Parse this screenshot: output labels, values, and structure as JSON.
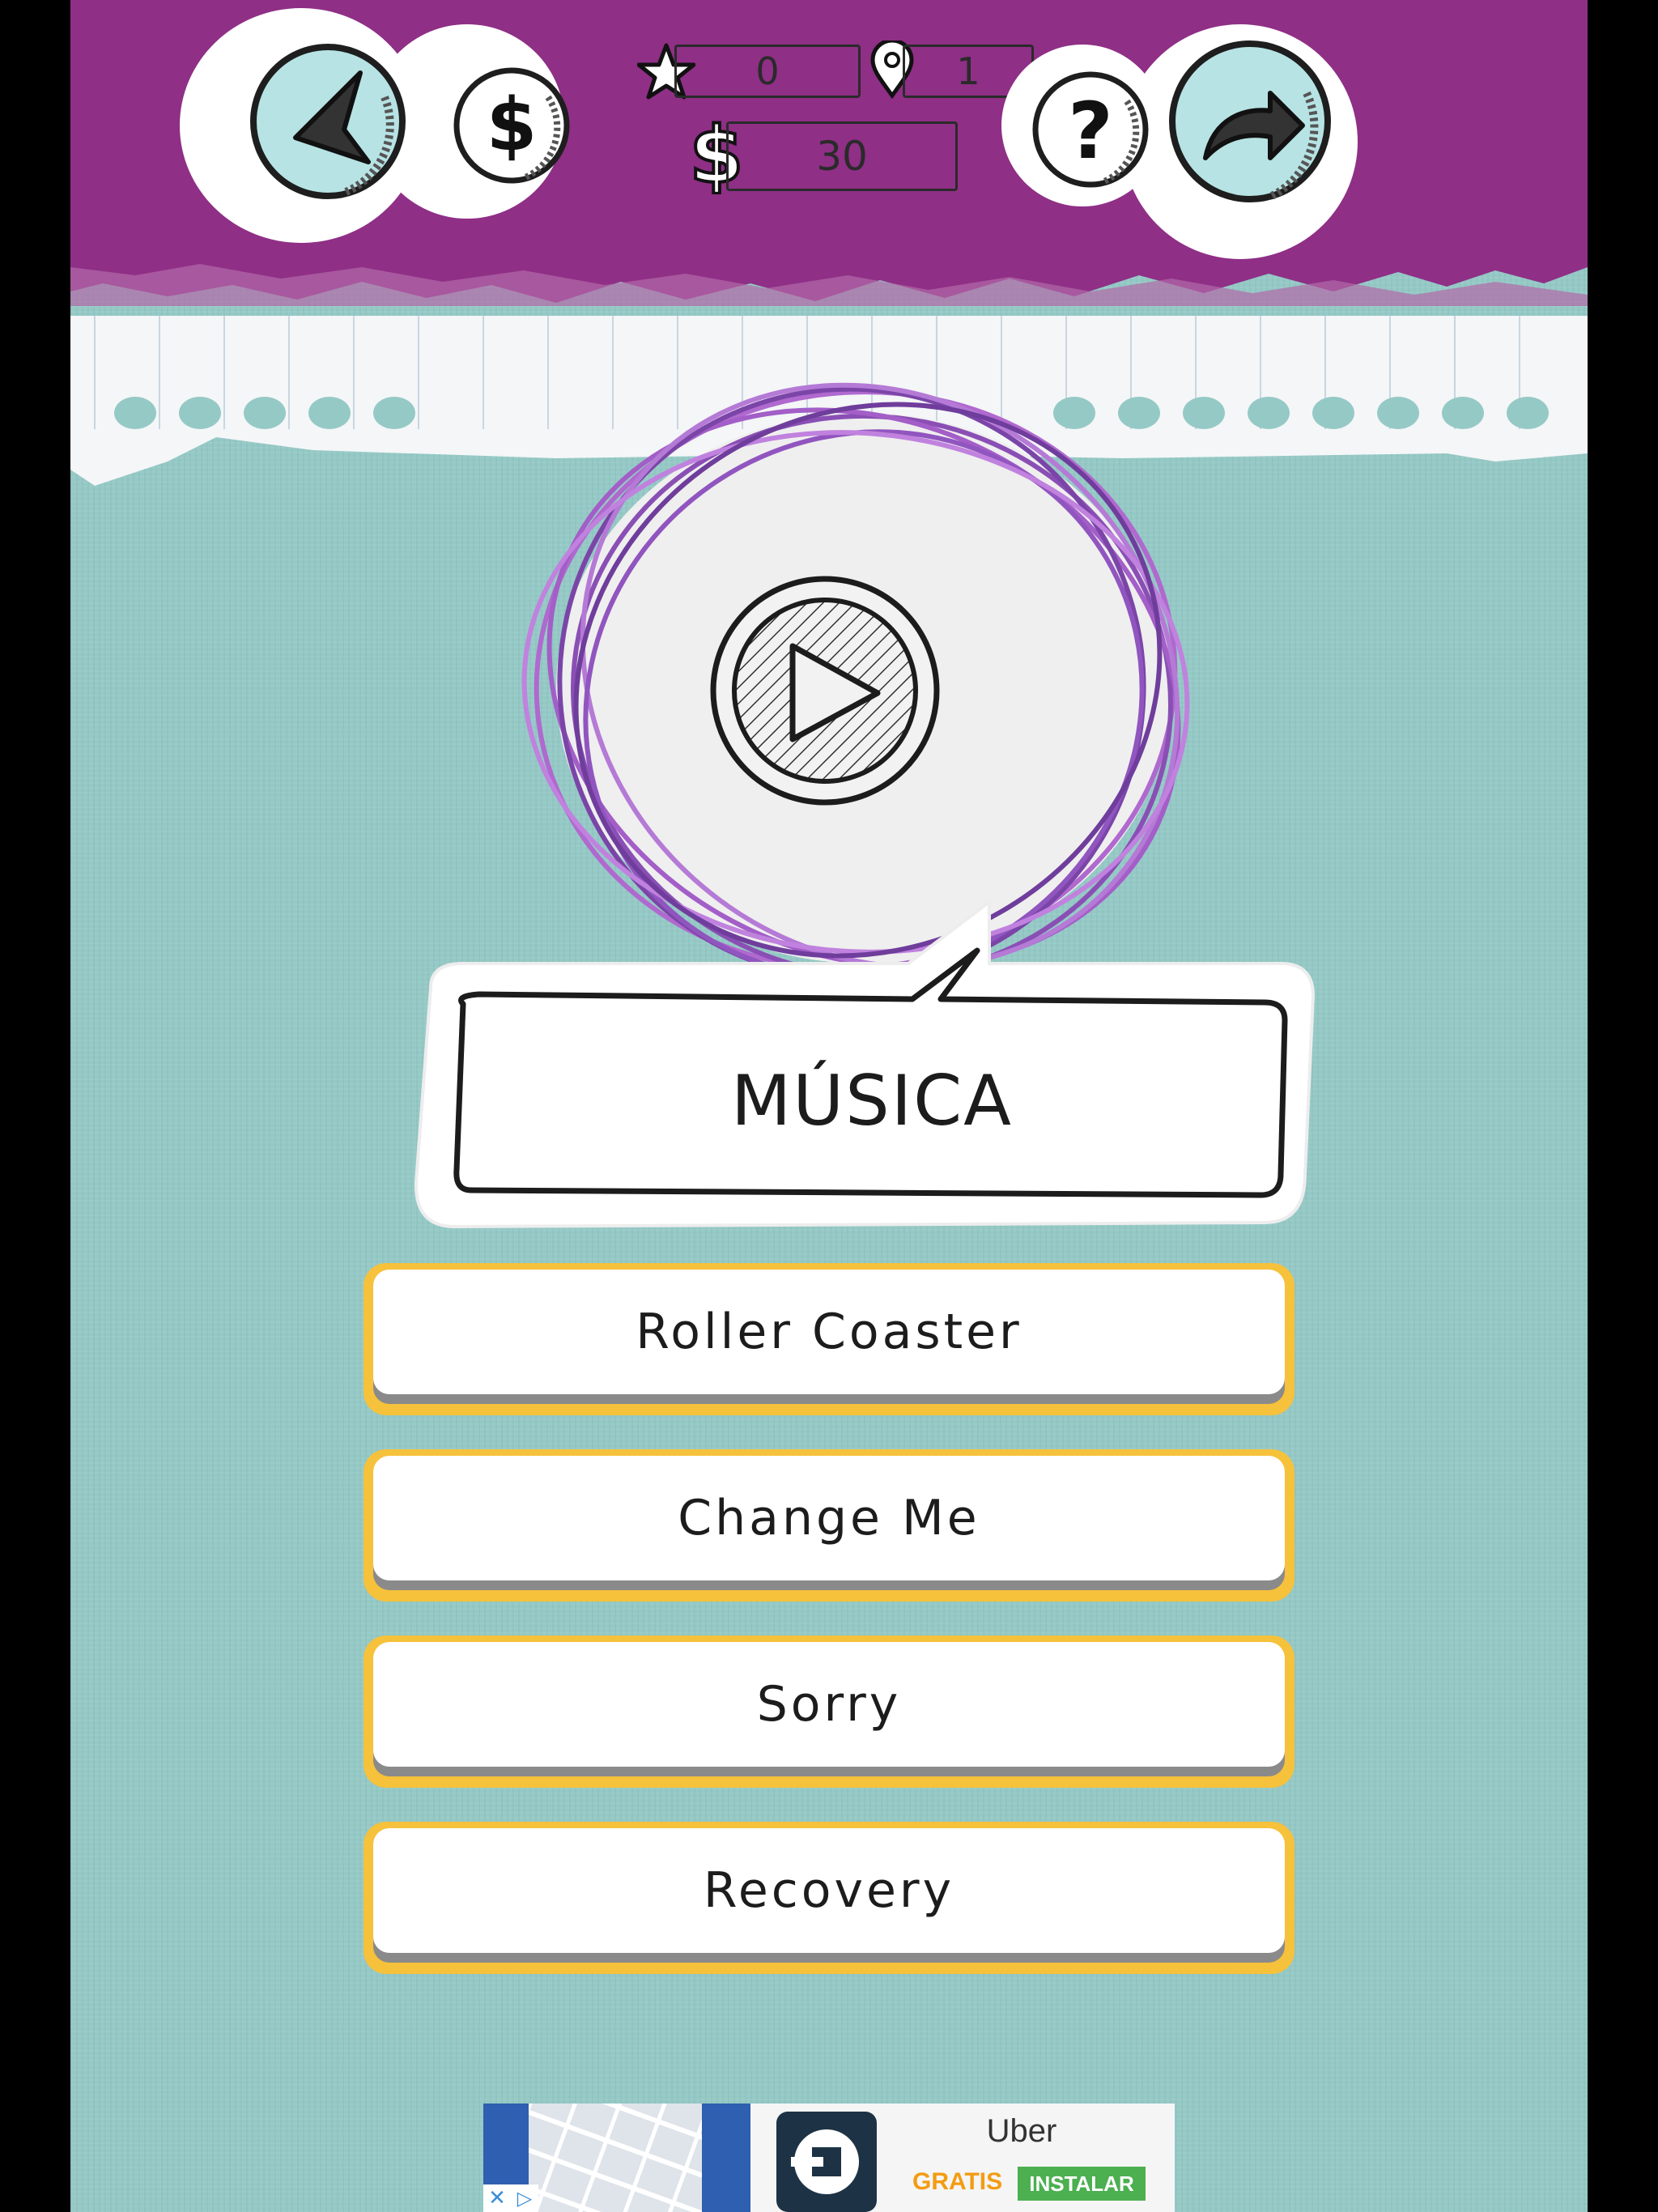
{
  "header": {
    "back_icon": "back-arrow-icon",
    "coins_icon": "dollar-icon",
    "help_icon": "question-mark-icon",
    "share_icon": "share-arrow-icon",
    "stars_icon": "star-icon",
    "location_icon": "map-pin-icon",
    "stars_value": "0",
    "level_value": "1",
    "coins_value": "30"
  },
  "play": {
    "icon": "play-icon"
  },
  "category": {
    "label": "MÚSICA"
  },
  "answers": [
    {
      "label": "Roller Coaster"
    },
    {
      "label": "Change Me"
    },
    {
      "label": "Sorry"
    },
    {
      "label": "Recovery"
    }
  ],
  "ad": {
    "title": "Uber",
    "free_label": "GRATIS",
    "install_label": "INSTALAR"
  },
  "colors": {
    "header_purple": "#8f2f86",
    "background_teal": "#95c9c6",
    "answer_border": "#f6c13b",
    "scribble_purple": "#a04fc0",
    "install_green": "#4caf50",
    "free_orange": "#f39c12"
  }
}
